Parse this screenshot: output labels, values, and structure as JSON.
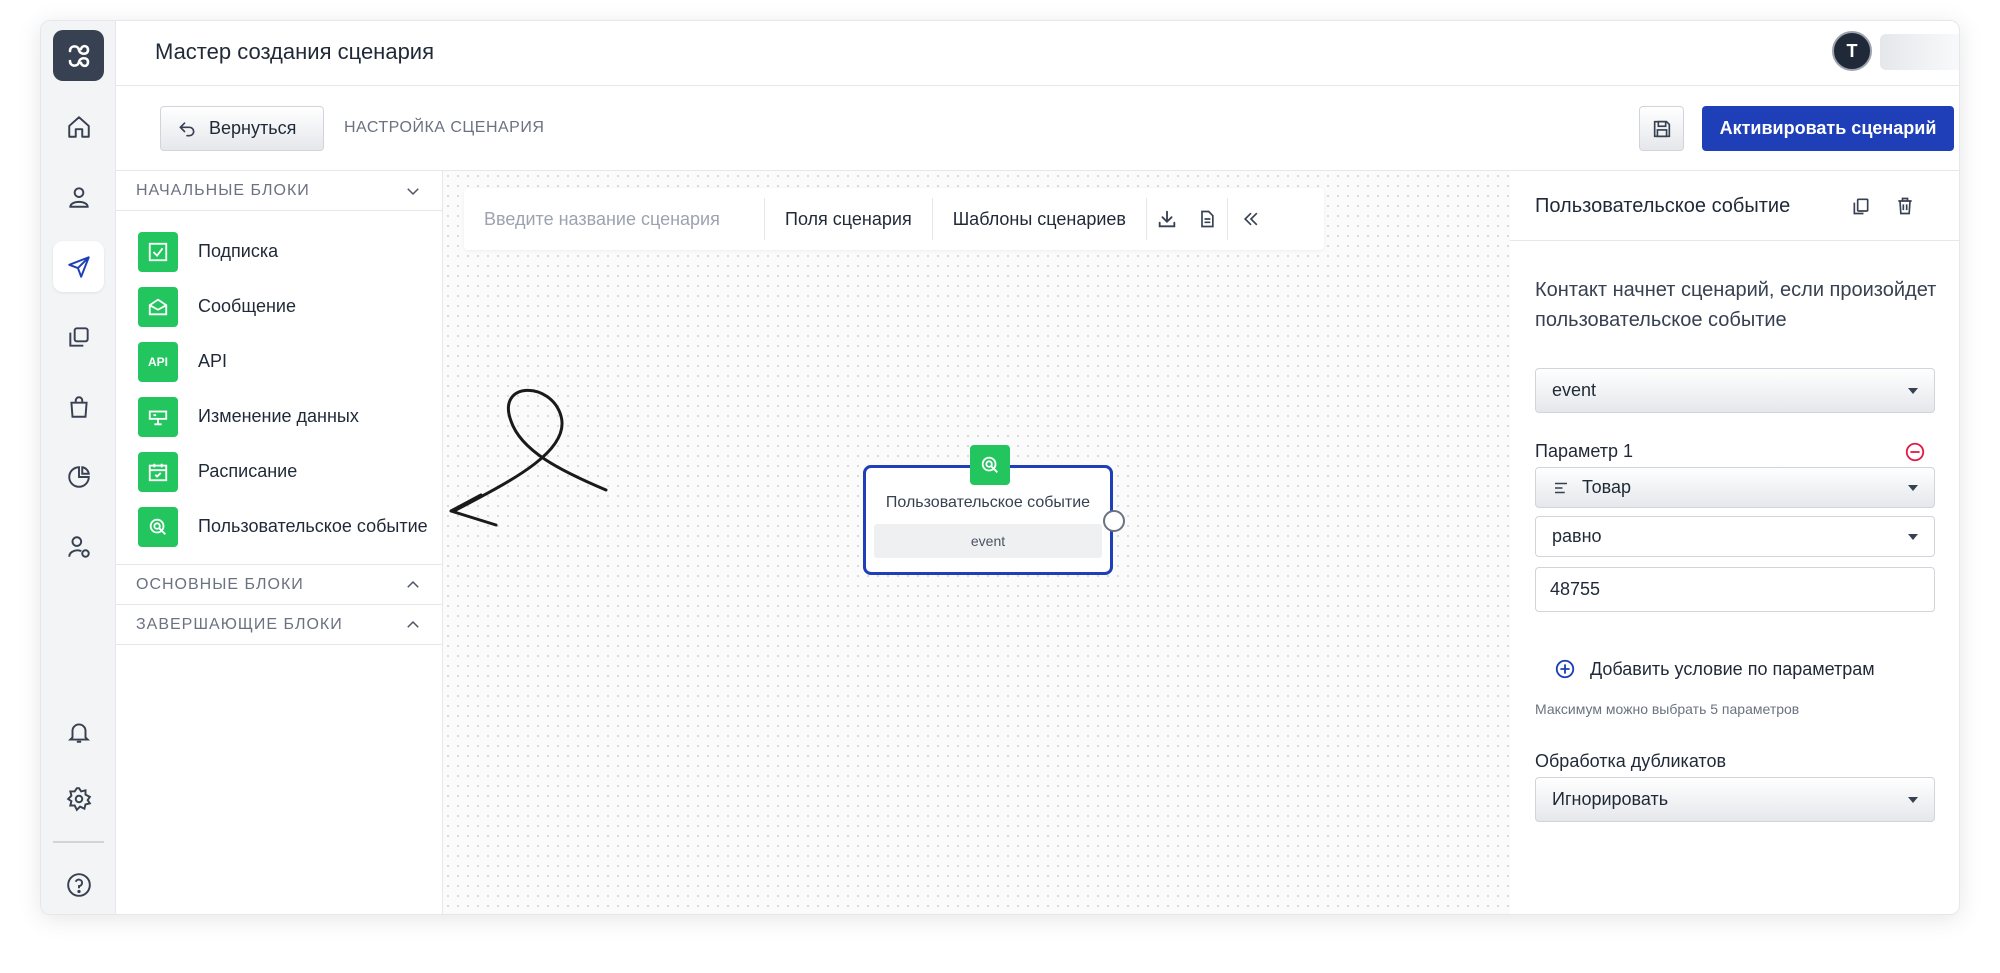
{
  "header": {
    "title": "Мастер создания сценария",
    "avatar_initial": "T"
  },
  "toolbar": {
    "back_label": "Вернуться",
    "breadcrumb": "НАСТРОЙКА СЦЕНАРИЯ",
    "activate_label": "Активировать сценарий"
  },
  "blocks_panel": {
    "start_section": "НАЧАЛЬНЫЕ БЛОКИ",
    "items": [
      {
        "label": "Подписка",
        "icon": "checkbox-icon"
      },
      {
        "label": "Сообщение",
        "icon": "envelope-open-icon"
      },
      {
        "label": "API",
        "icon": "api-icon",
        "icon_text": "API"
      },
      {
        "label": "Изменение данных",
        "icon": "data-edit-icon"
      },
      {
        "label": "Расписание",
        "icon": "calendar-icon"
      },
      {
        "label": "Пользовательское событие",
        "icon": "click-event-icon"
      }
    ],
    "main_section": "ОСНОВНЫЕ БЛОКИ",
    "final_section": "ЗАВЕРШАЮЩИЕ БЛОКИ"
  },
  "canvas": {
    "name_placeholder": "Введите название сценария",
    "fields_label": "Поля сценария",
    "templates_label": "Шаблоны сценариев",
    "node": {
      "title": "Пользовательское событие",
      "tag": "event"
    }
  },
  "properties": {
    "title": "Пользовательское событие",
    "description": "Контакт начнет сценарий, если произойдет пользовательское событие",
    "event_select": "event",
    "param_label": "Параметр 1",
    "param_field": "Товар",
    "operator": "равно",
    "value": "48755",
    "add_condition": "Добавить условие по параметрам",
    "max_hint": "Максимум можно выбрать 5 параметров",
    "duplicates_label": "Обработка дубликатов",
    "duplicates_value": "Игнорировать"
  },
  "colors": {
    "accent": "#1e3fb8",
    "block_green": "#22c55e",
    "danger": "#e11d48"
  }
}
